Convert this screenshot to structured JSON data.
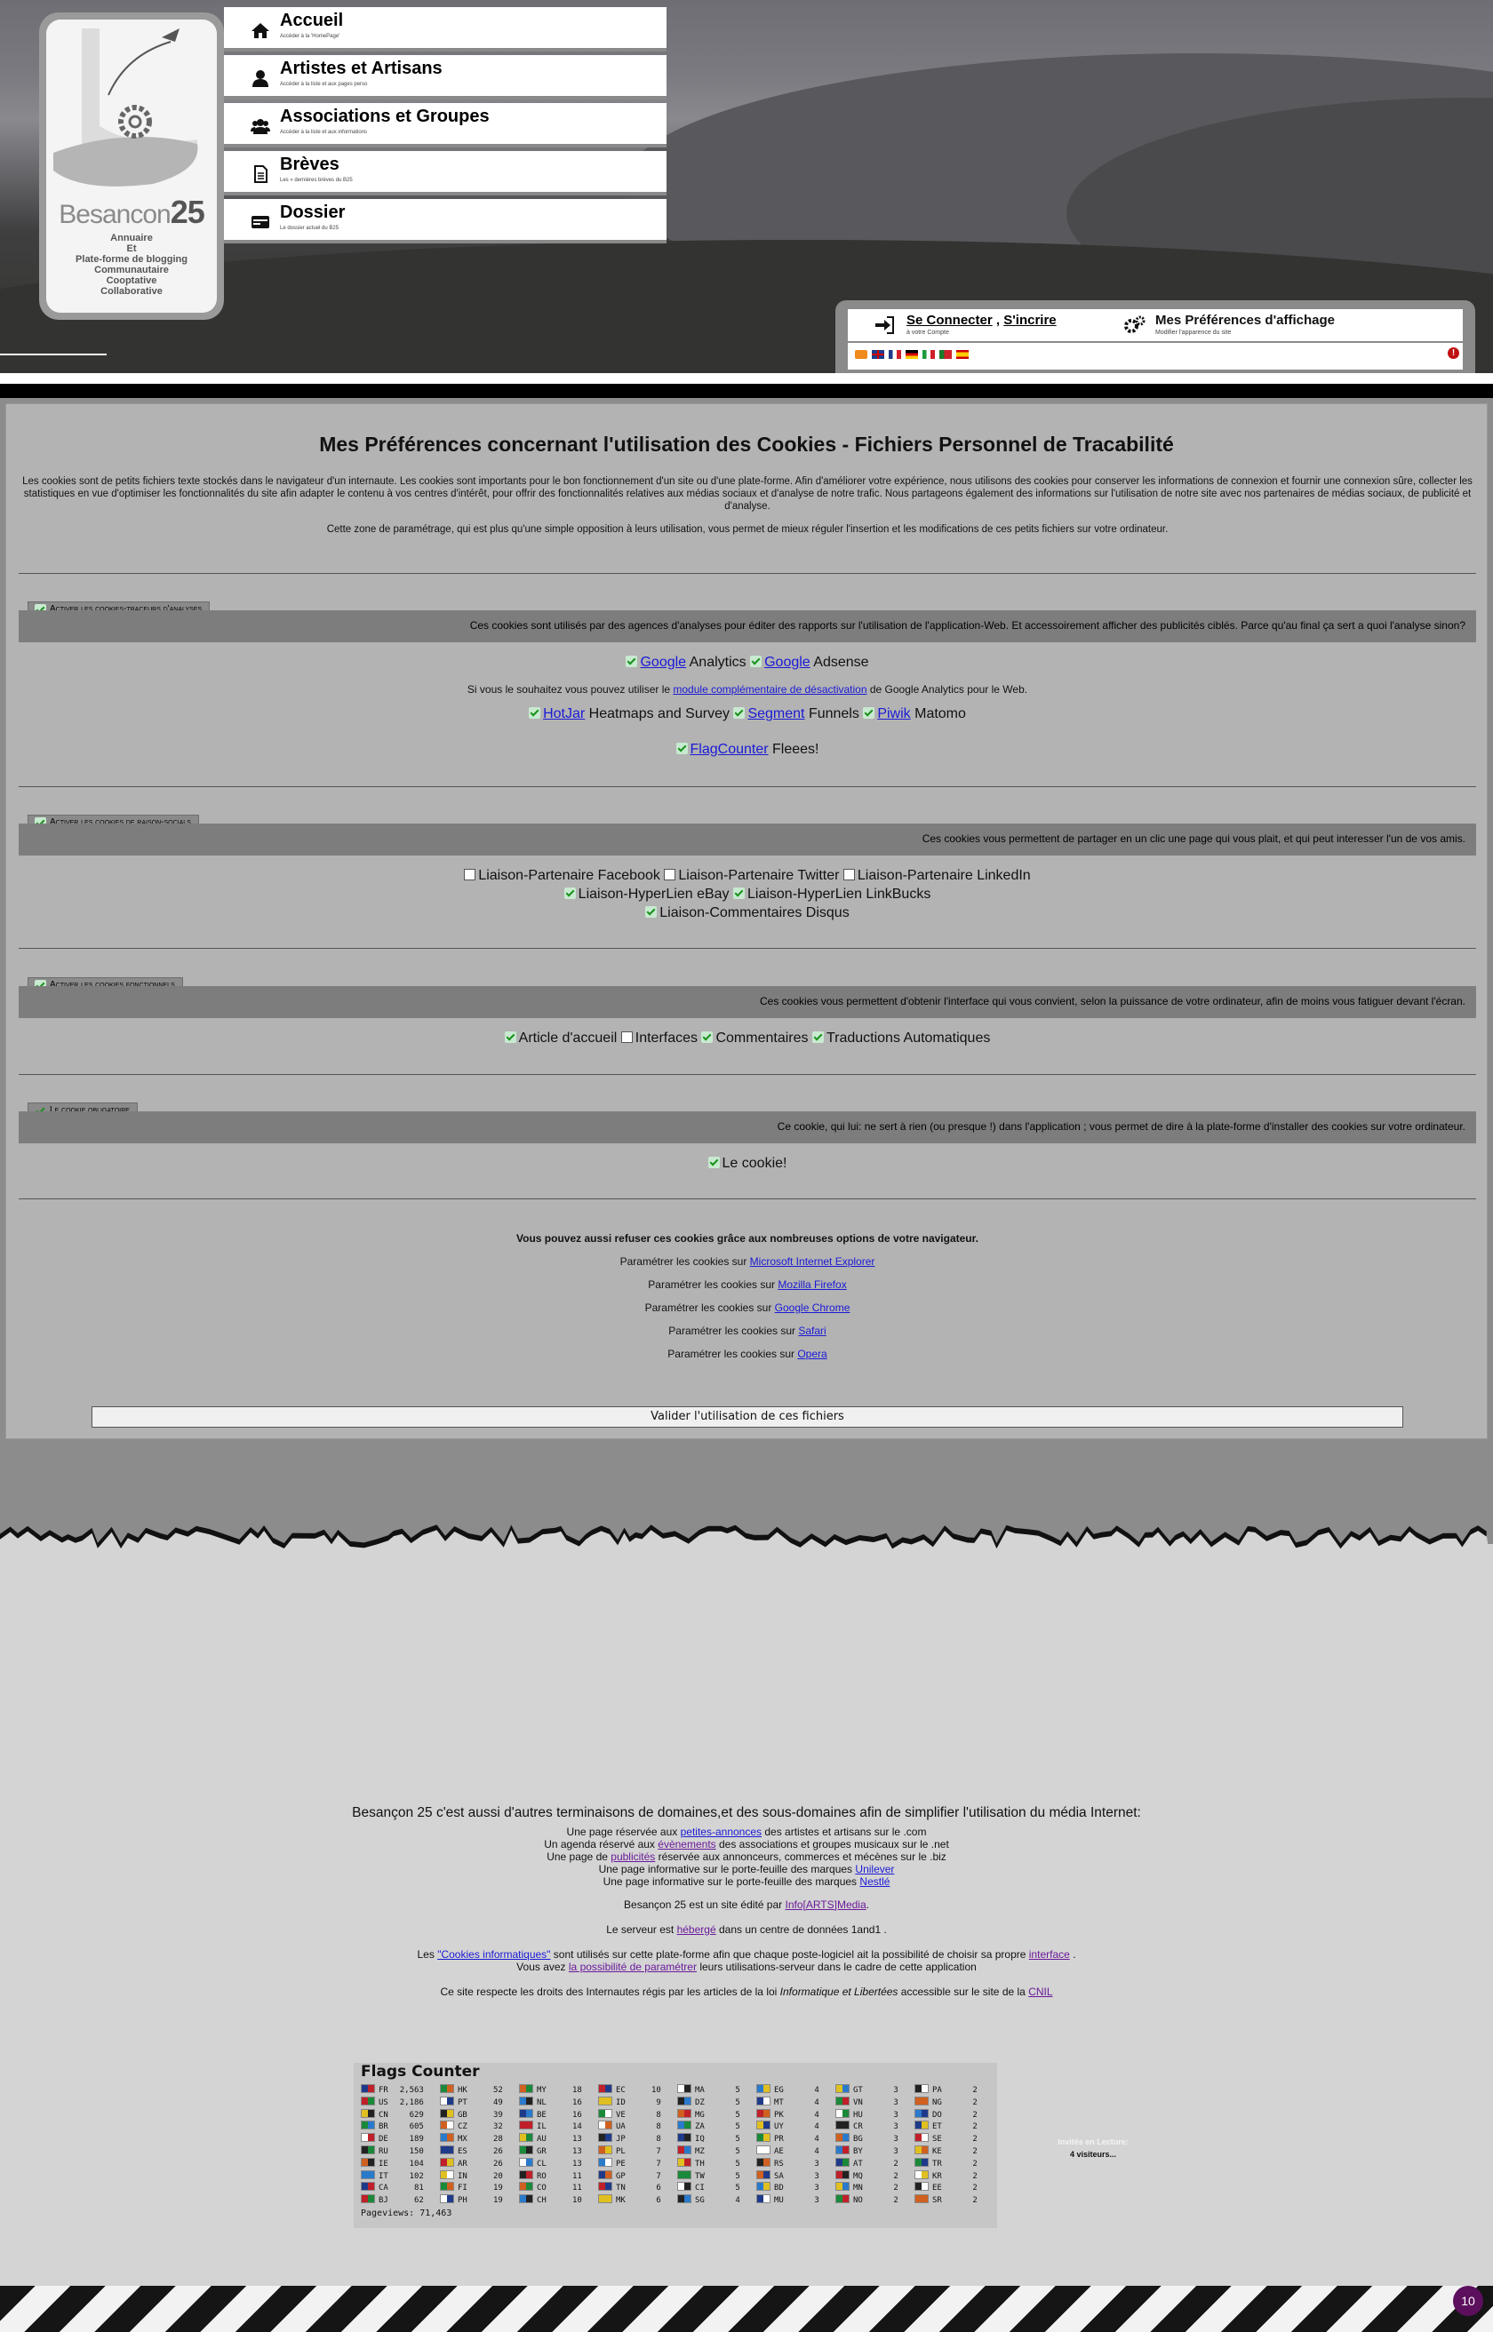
{
  "logo": {
    "brand_name": "Besancon",
    "brand_num": "25",
    "tagline": [
      "Annuaire",
      "Et",
      "Plate-forme de blogging",
      "Communautaire",
      "Cooptative",
      "Collaborative"
    ],
    "icon": "gear-bird-hat-logo"
  },
  "nav": [
    {
      "label": "Accueil",
      "sub": "Accéder à la 'HomePage'",
      "icon": "home-icon"
    },
    {
      "label": "Artistes et Artisans",
      "sub": "Accéder à la liste et aux pages perso",
      "icon": "user-icon"
    },
    {
      "label": "Associations et Groupes",
      "sub": "Accéder à la liste et aux informations",
      "icon": "users-icon"
    },
    {
      "label": "Brèves",
      "sub": "Les « dernières brèves du B25",
      "icon": "document-icon"
    },
    {
      "label": "Dossier",
      "sub": "Le dossier actuel du B25",
      "icon": "folder-icon"
    }
  ],
  "user": {
    "login": "Se Connecter",
    "sep": ",",
    "signup": "S'incrire",
    "login_sub": "à votre Compte",
    "prefs": "Mes Préférences d'affichage",
    "prefs_sub": "Modifier l'apparence du site",
    "alert": "!",
    "flags": [
      "rss-icon",
      "uk-flag",
      "fr-flag",
      "de-flag",
      "it-flag",
      "pt-flag",
      "es-flag"
    ]
  },
  "cookies": {
    "title": "Mes Préférences concernant l'utilisation des Cookies - Fichiers Personnel de Tracabilité",
    "intro": "Les cookies sont de petits fichiers texte stockés dans le navigateur d'un internaute. Les cookies sont importants pour le bon fonctionnement d'un site ou d'une plate-forme. Afin d'améliorer votre expérience, nous utilisons des cookies pour conserver les informations de connexion et fournir une connexion sûre, collecter les statistiques en vue d'optimiser les fonctionnalités du site afin adapter le contenu à vos centres d'intérêt, pour offrir des fonctionnalités relatives aux médias sociaux et d'analyse de notre trafic. Nous partageons également des informations sur l'utilisation de notre site avec nos partenaires de médias sociaux, de publicité et d'analyse.",
    "intro2": "Cette zone de paramétrage, qui est plus qu'une simple opposition à leurs utilisation, vous permet de mieux réguler l'insertion et les modifications de ces petits fichiers sur votre ordinateur.",
    "sections": [
      {
        "head": "Activer les cookies-traceurs d'analyses",
        "bar": "Ces cookies sont utilisés par des agences d'analyses pour éditer des rapports sur l'utilisation de l'application-Web. Et accessoirement afficher des publicités ciblés. Parce qu'au final ça sert a quoi l'analyse sinon?"
      },
      {
        "head": "Activer les cookies de raison-socials",
        "bar": "Ces cookies vous permettent de partager en un clic une page qui vous plait, et qui peut interesser l'un de vos amis."
      },
      {
        "head": "Activer les cookies fonctionnels",
        "bar": "Ces cookies vous permettent d'obtenir l'interface qui vous convient, selon la puissance de votre ordinateur, afin de moins vous fatiguer devant l'écran."
      },
      {
        "head": "Le cookie obligatoire",
        "bar": "Ce cookie, qui lui: ne sert à rien (ou presque !) dans l'application ; vous permet de dire à la plate-forme d'installer des cookies sur votre ordinateur."
      }
    ],
    "analytics": {
      "google": "Google",
      "analytics": "Analytics",
      "adsense": "Adsense",
      "optout_pre": "Si vous le souhaitez vous pouvez utiliser le",
      "optout_link": "module complémentaire de désactivation",
      "optout_post": "de Google Analytics pour le Web.",
      "hotjar": "HotJar",
      "hotjar_rest": "Heatmaps and Survey",
      "segment": "Segment",
      "segment_rest": "Funnels",
      "piwik": "Piwik",
      "piwik_rest": "Matomo",
      "flagcounter": "FlagCounter",
      "flagcounter_rest": "Fleees!"
    },
    "social": [
      {
        "label": "Liaison-Partenaire Facebook",
        "checked": false
      },
      {
        "label": "Liaison-Partenaire Twitter",
        "checked": false
      },
      {
        "label": "Liaison-Partenaire LinkedIn",
        "checked": false
      },
      {
        "label": "Liaison-HyperLien eBay",
        "checked": true
      },
      {
        "label": "Liaison-HyperLien LinkBucks",
        "checked": true
      },
      {
        "label": "Liaison-Commentaires Disqus",
        "checked": true
      }
    ],
    "functional": [
      {
        "label": "Article d'accueil",
        "checked": true
      },
      {
        "label": "Interfaces",
        "checked": false
      },
      {
        "label": "Commentaires",
        "checked": true
      },
      {
        "label": "Traductions Automatiques",
        "checked": true
      }
    ],
    "mandatory": "Le cookie!",
    "refuse": "Vous pouvez aussi refuser ces cookies grâce aux nombreuses options de votre navigateur.",
    "browser_pre": "Paramétrer les cookies sur",
    "browsers": [
      "Microsoft Internet Explorer",
      "Mozilla Firefox",
      "Google Chrome",
      "Safari",
      "Opera"
    ],
    "validate": "Valider l'utilisation de ces fichiers"
  },
  "footer": {
    "headline": "Besançon 25 c'est aussi d'autres terminaisons de domaines,et des sous-domaines afin de simplifier l'utilisation du média Internet:",
    "l1_pre": "Une page réservée aux",
    "l1_link": "petites-annonces",
    "l1_post": "des artistes et artisans sur le .com",
    "l2_pre": "Un agenda réservé aux",
    "l2_link": "évènements",
    "l2_post": "des associations et groupes musicaux sur le .net",
    "l3_pre": "Une page de",
    "l3_link": "publicités",
    "l3_post": "réservée aux annonceurs, commerces et mécènes sur le .biz",
    "l4_pre": "Une page informative sur le porte-feuille des marques",
    "l4_link": "Unilever",
    "l5_pre": "Une page informative sur le porte-feuille des marques",
    "l5_link": "Nestlé",
    "editor_pre": "Besançon 25 est un site édité par",
    "editor_link": "Info[ARTS]Media",
    "editor_post": ".",
    "host_pre": "Le serveur est",
    "host_link": "hébergé",
    "host_post": "dans un centre de données 1and1 .",
    "ck_pre": "Les",
    "ck_link": "\"Cookies informatiques\"",
    "ck_mid": "sont utilisés sur cette plate-forme afin que chaque poste-logiciel ait la possibilité de choisir sa propre",
    "ck_link2": "interface",
    "ck_post": ".",
    "ck2_pre": "Vous avez",
    "ck2_link": "la possibilité de paramétrer",
    "ck2_post": "leurs utilisations-serveur dans le cadre de cette application",
    "law_pre": "Ce site respecte les droits des Internautes régis par les articles de la loi",
    "law_em": "Informatique et Libertées",
    "law_mid": "accessible sur le site de la",
    "law_link": "CNIL",
    "invite_title": "Invités en Lecture:",
    "invite_count": "4 visiteurs..."
  },
  "flags_counter": {
    "title": "Flags Counter",
    "pageviews": "Pageviews: 71,463",
    "columns": [
      [
        [
          "FR",
          "2,563"
        ],
        [
          "US",
          "2,186"
        ],
        [
          "CN",
          "629"
        ],
        [
          "BR",
          "605"
        ],
        [
          "DE",
          "189"
        ],
        [
          "RU",
          "150"
        ],
        [
          "IE",
          "104"
        ],
        [
          "IT",
          "102"
        ],
        [
          "CA",
          "81"
        ],
        [
          "BJ",
          "62"
        ]
      ],
      [
        [
          "HK",
          "52"
        ],
        [
          "PT",
          "49"
        ],
        [
          "GB",
          "39"
        ],
        [
          "CZ",
          "32"
        ],
        [
          "MX",
          "28"
        ],
        [
          "ES",
          "26"
        ],
        [
          "AR",
          "26"
        ],
        [
          "IN",
          "20"
        ],
        [
          "FI",
          "19"
        ],
        [
          "PH",
          "19"
        ]
      ],
      [
        [
          "MY",
          "18"
        ],
        [
          "NL",
          "16"
        ],
        [
          "BE",
          "16"
        ],
        [
          "IL",
          "14"
        ],
        [
          "AU",
          "13"
        ],
        [
          "GR",
          "13"
        ],
        [
          "CL",
          "13"
        ],
        [
          "RO",
          "11"
        ],
        [
          "CO",
          "11"
        ],
        [
          "CH",
          "10"
        ]
      ],
      [
        [
          "EC",
          "10"
        ],
        [
          "ID",
          "9"
        ],
        [
          "VE",
          "8"
        ],
        [
          "UA",
          "8"
        ],
        [
          "JP",
          "8"
        ],
        [
          "PL",
          "7"
        ],
        [
          "PE",
          "7"
        ],
        [
          "GP",
          "7"
        ],
        [
          "TN",
          "6"
        ],
        [
          "MK",
          "6"
        ]
      ],
      [
        [
          "MA",
          "5"
        ],
        [
          "DZ",
          "5"
        ],
        [
          "MG",
          "5"
        ],
        [
          "ZA",
          "5"
        ],
        [
          "IQ",
          "5"
        ],
        [
          "MZ",
          "5"
        ],
        [
          "TH",
          "5"
        ],
        [
          "TW",
          "5"
        ],
        [
          "CI",
          "5"
        ],
        [
          "SG",
          "4"
        ]
      ],
      [
        [
          "EG",
          "4"
        ],
        [
          "MT",
          "4"
        ],
        [
          "PK",
          "4"
        ],
        [
          "UY",
          "4"
        ],
        [
          "PR",
          "4"
        ],
        [
          "AE",
          "4"
        ],
        [
          "RS",
          "3"
        ],
        [
          "SA",
          "3"
        ],
        [
          "BD",
          "3"
        ],
        [
          "MU",
          "3"
        ]
      ],
      [
        [
          "GT",
          "3"
        ],
        [
          "VN",
          "3"
        ],
        [
          "HU",
          "3"
        ],
        [
          "CR",
          "3"
        ],
        [
          "BG",
          "3"
        ],
        [
          "BY",
          "3"
        ],
        [
          "AT",
          "2"
        ],
        [
          "MQ",
          "2"
        ],
        [
          "MN",
          "2"
        ],
        [
          "NO",
          "2"
        ]
      ],
      [
        [
          "PA",
          "2"
        ],
        [
          "NG",
          "2"
        ],
        [
          "DO",
          "2"
        ],
        [
          "ET",
          "2"
        ],
        [
          "SE",
          "2"
        ],
        [
          "KE",
          "2"
        ],
        [
          "TR",
          "2"
        ],
        [
          "KR",
          "2"
        ],
        [
          "EE",
          "2"
        ],
        [
          "SR",
          "2"
        ]
      ]
    ]
  },
  "badge": "10",
  "colors": {
    "accent": "#5b0f5d",
    "panel": "#b3b3b3",
    "link": "#1a1ad6"
  }
}
